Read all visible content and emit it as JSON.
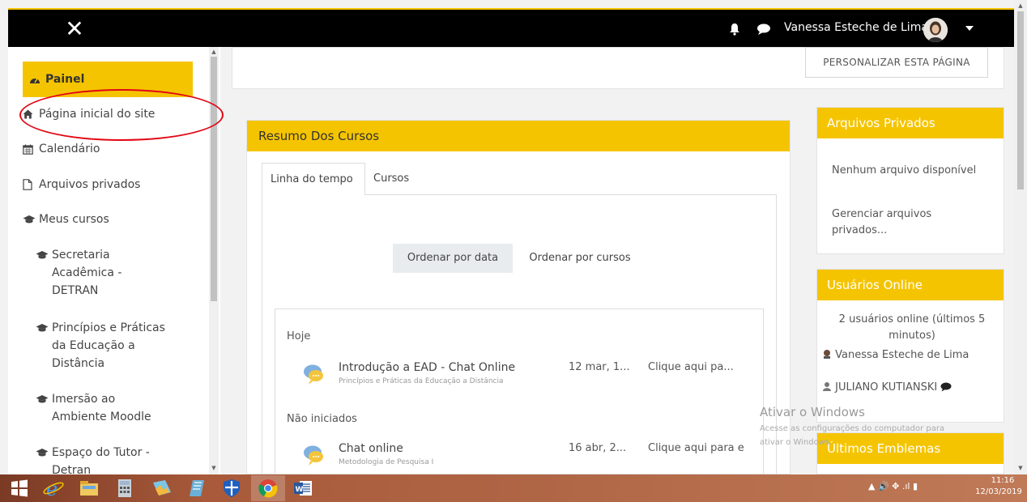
{
  "topbar": {
    "close_glyph": "✕",
    "user_name": "Vanessa Esteche de Lima"
  },
  "sidebar": {
    "items": [
      {
        "label": "Painel",
        "icon": "dashboard-icon"
      },
      {
        "label": "Página inicial do site",
        "icon": "home-icon"
      },
      {
        "label": "Calendário",
        "icon": "calendar-icon"
      },
      {
        "label": "Arquivos privados",
        "icon": "file-icon"
      },
      {
        "label": "Meus cursos",
        "icon": "graduation-cap-icon"
      }
    ],
    "courses": [
      {
        "label": "Secretaria Acadêmica - DETRAN"
      },
      {
        "label": "Princípios e Práticas da Educação a Distância"
      },
      {
        "label": "Imersão ao Ambiente Moodle"
      },
      {
        "label": "Espaço do Tutor - Detran"
      }
    ]
  },
  "main": {
    "customize_label": "PERSONALIZAR ESTA PÁGINA",
    "course_overview": {
      "title": "Resumo Dos Cursos",
      "tabs": [
        "Linha do tempo",
        "Cursos"
      ],
      "sort_by_date": "Ordenar por data",
      "sort_by_course": "Ordenar por cursos",
      "groups": [
        {
          "label": "Hoje",
          "events": [
            {
              "title": "Introdução a EAD - Chat Online",
              "course": "Princípios e Práticas da Educação a Distância",
              "date": "12 mar, 1...",
              "action": "Clique aqui pa..."
            }
          ]
        },
        {
          "label": "Não iniciados",
          "events": [
            {
              "title": "Chat online",
              "course": "Metodologia de Pesquisa I",
              "date": "16 abr, 2...",
              "action": "Clique aqui para e"
            }
          ]
        }
      ]
    }
  },
  "right": {
    "private_files": {
      "title": "Arquivos Privados",
      "empty": "Nenhum arquivo disponível",
      "manage": "Gerenciar arquivos privados..."
    },
    "online_users": {
      "title": "Usuários Online",
      "summary": "2 usuários online (últimos 5 minutos)",
      "users": [
        "Vanessa Esteche de Lima",
        "JULIANO KUTIANSKI"
      ]
    },
    "badges": {
      "title": "Últimos Emblemas"
    }
  },
  "watermark": {
    "title": "Ativar o Windows",
    "line1": "Acesse as configurações do computador para",
    "line2": "ativar o Windows."
  },
  "taskbar": {
    "tray_icons": "▲  🔊  ✥  .ıl  ▮",
    "time": "11:16",
    "date": "12/03/2019"
  },
  "colors": {
    "accent": "#f5c400",
    "annotation": "#e30613",
    "topbar": "#000000"
  }
}
